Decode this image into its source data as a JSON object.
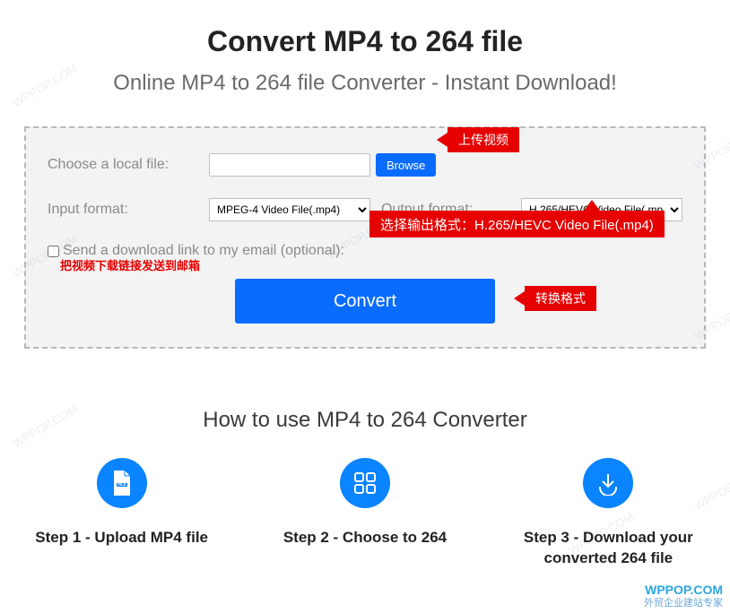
{
  "title": "Convert MP4 to 264 file",
  "subtitle": "Online MP4 to 264 file Converter - Instant Download!",
  "form": {
    "choose_label": "Choose a local file:",
    "file_value": "",
    "browse_label": "Browse",
    "input_format_label": "Input format:",
    "input_format_value": "MPEG-4 Video File(.mp4)",
    "output_format_label": "Output format:",
    "output_format_value": "H.265/HEVC Video File(.mp4)",
    "email_checkbox_label": "Send a download link to my email (optional):",
    "convert_label": "Convert"
  },
  "annotations": {
    "upload": "上传视频",
    "select_output": "选择输出格式：H.265/HEVC Video File(.mp4)",
    "email_note": "把视频下载链接发送到邮箱",
    "convert_note": "转换格式"
  },
  "howto": {
    "title": "How to use MP4 to 264 Converter",
    "step1": "Step 1 - Upload MP4 file",
    "step2": "Step 2 - Choose to 264",
    "step3": "Step 3 - Download your converted 264 file"
  },
  "watermark": {
    "brand": "WPPOP.COM",
    "sub": "外贸企业建站专家"
  }
}
